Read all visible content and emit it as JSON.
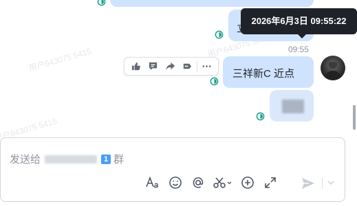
{
  "tooltip": {
    "datetime": "2026年6月3日 09:55:22"
  },
  "message": {
    "time": "09:55",
    "text": "三祥新C  近点"
  },
  "watermarks": [
    "用户643075 5415",
    "用户643075 5415",
    "用户643075 5415"
  ],
  "composer": {
    "prefix": "发送给",
    "badge": "1",
    "suffix": "群",
    "tools": [
      "font-format-icon",
      "emoji-icon",
      "mention-icon",
      "scissors-icon",
      "add-icon",
      "expand-icon"
    ],
    "send_icon": "send-icon"
  },
  "actions": [
    "thumbs-up-icon",
    "reply-icon",
    "forward-icon",
    "pin-icon",
    "more-icon"
  ],
  "colors": {
    "bubble": "#cfe3ff",
    "status": "#14a08a",
    "tooltip": "#1f2329",
    "badge": "#4a9ef7"
  }
}
